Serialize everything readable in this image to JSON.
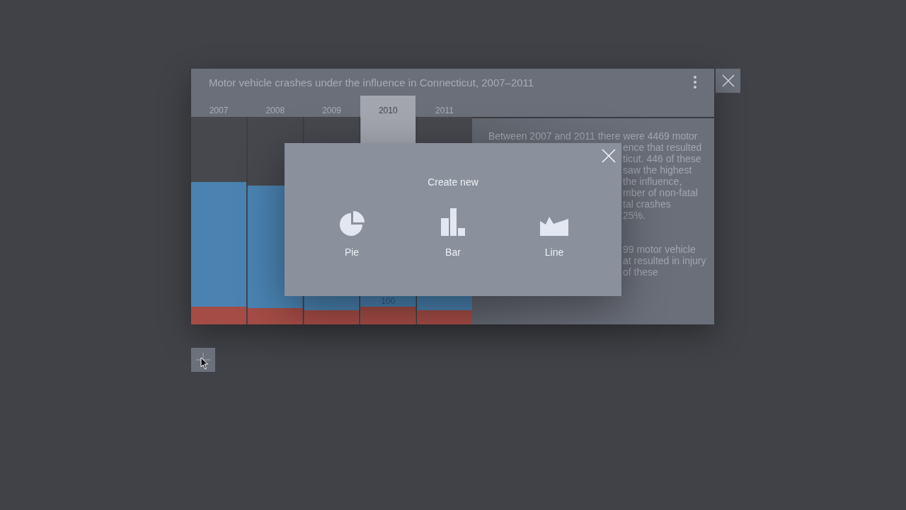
{
  "card": {
    "title": "Motor vehicle crashes under the influence in Connecticut, 2007–2011",
    "tabs": [
      {
        "label": "2007",
        "selected": false
      },
      {
        "label": "2008",
        "selected": false
      },
      {
        "label": "2009",
        "selected": false
      },
      {
        "label": "2010",
        "selected": true
      },
      {
        "label": "2011",
        "selected": false
      }
    ],
    "chart": {
      "value_label": "100"
    },
    "summary": [
      {
        "lines": [
          {
            "text": "Between 2007 and 2011 there were 4469 motor",
            "cut": false
          },
          {
            "text": "ence that resulted",
            "cut": true
          },
          {
            "text": "ticut. 446 of these",
            "cut": true
          },
          {
            "text": "saw the highest",
            "cut": true
          },
          {
            "text": "the influence,",
            "cut": true
          },
          {
            "text": "mber of non-fatal",
            "cut": true
          },
          {
            "text": "tal crashes",
            "cut": true
          },
          {
            "text": "25%.",
            "cut": true
          }
        ]
      },
      {
        "lines": [
          {
            "text": "99 motor vehicle",
            "cut": true
          },
          {
            "text": "at resulted in injury",
            "cut": true
          },
          {
            "text": "of these",
            "cut": true
          }
        ]
      }
    ]
  },
  "dialog": {
    "title": "Create new",
    "options": [
      {
        "kind": "pie",
        "label": "Pie"
      },
      {
        "kind": "bar",
        "label": "Bar"
      },
      {
        "kind": "line",
        "label": "Line"
      }
    ]
  }
}
